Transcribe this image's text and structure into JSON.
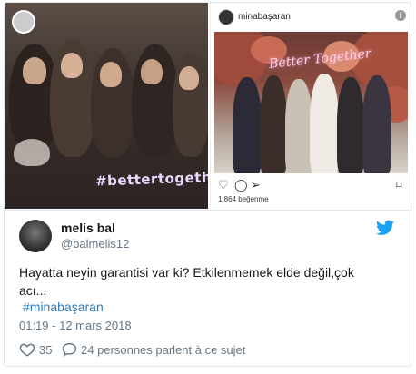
{
  "instagram": {
    "username": "minabaşaran",
    "likes": "1.864 beğenme",
    "neon_sign": "Better Together"
  },
  "story": {
    "hashtag": "#bettertogether"
  },
  "tweet": {
    "display_name": "melis bal",
    "handle": "@balmelis12",
    "text": "Hayatta neyin garantisi var ki? Etkilenmemek elde değil,çok acı...",
    "hashtag": "#minabaşaran",
    "timestamp": "01:19 - 12 mars 2018",
    "like_count": "35",
    "talk_text": "24 personnes parlent à ce sujet"
  },
  "colors": {
    "twitter_blue": "#1da1f2",
    "link": "#2b7bb9",
    "muted": "#657786"
  }
}
